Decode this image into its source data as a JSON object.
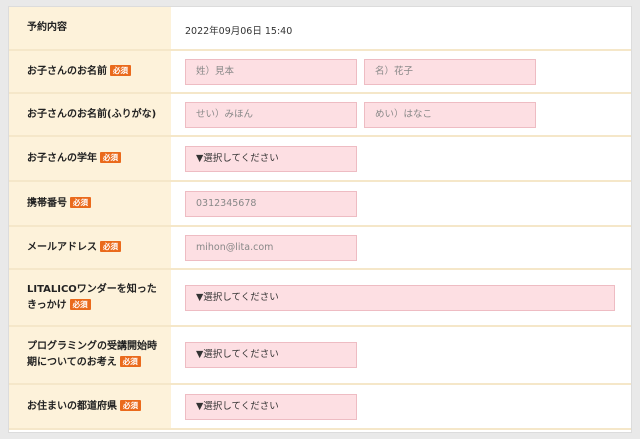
{
  "form": {
    "required_badge": "必須",
    "rows": {
      "reservation": {
        "label": "予約内容",
        "value": "2022年09月06日 15:40"
      },
      "child_name": {
        "label": "お子さんのお名前",
        "last_placeholder": "姓）見本",
        "first_placeholder": "名）花子"
      },
      "child_kana": {
        "label": "お子さんのお名前(ふりがな)",
        "last_placeholder": "せい）みほん",
        "first_placeholder": "めい）はなこ"
      },
      "grade": {
        "label": "お子さんの学年",
        "select": "▼選択してください"
      },
      "phone": {
        "label": "携帯番号",
        "placeholder": "0312345678"
      },
      "email": {
        "label": "メールアドレス",
        "placeholder": "mihon@lita.com"
      },
      "trigger": {
        "label_line1": "LITALICOワンダーを知った",
        "label_line2": "きっかけ",
        "select": "▼選択してください"
      },
      "timing": {
        "label_line1": "プログラミングの受講開始時",
        "label_line2": "期についてのお考え",
        "select": "▼選択してください"
      },
      "prefecture": {
        "label": "お住まいの都道府県",
        "select": "▼選択してください"
      }
    }
  }
}
